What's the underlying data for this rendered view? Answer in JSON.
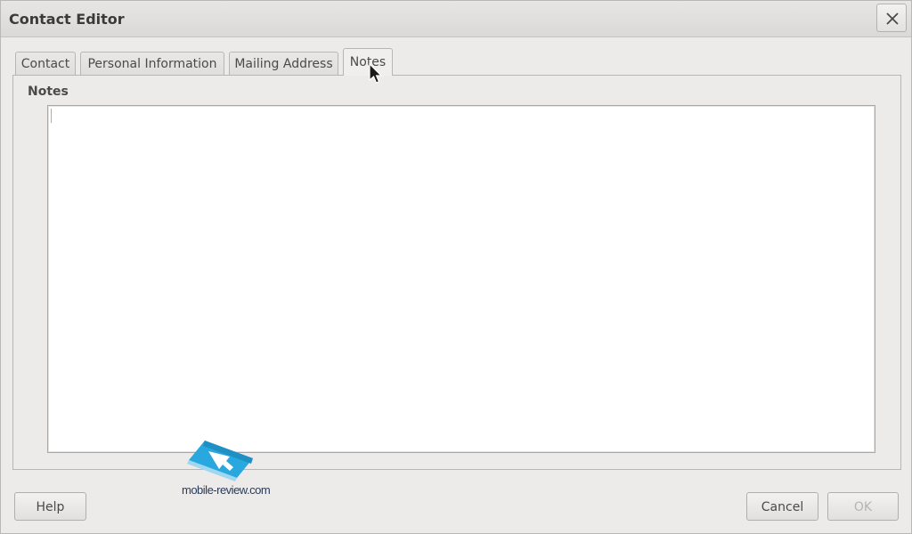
{
  "window": {
    "title": "Contact Editor"
  },
  "tabs": [
    {
      "label": "Contact",
      "active": false
    },
    {
      "label": "Personal Information",
      "active": false
    },
    {
      "label": "Mailing Address",
      "active": false
    },
    {
      "label": "Notes",
      "active": true
    }
  ],
  "notes": {
    "section_label": "Notes",
    "value": ""
  },
  "buttons": {
    "help": "Help",
    "cancel": "Cancel",
    "ok": "OK",
    "ok_enabled": false
  },
  "watermark": {
    "text": "mobile-review.com"
  },
  "colors": {
    "window_bg": "#ecebea",
    "caret": "#9fc166",
    "watermark_blue": "#29a8e0"
  }
}
